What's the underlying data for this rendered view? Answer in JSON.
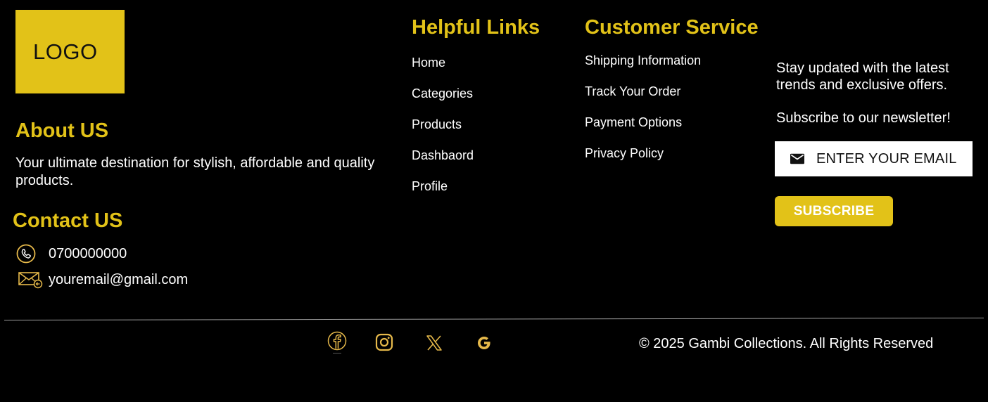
{
  "logo": {
    "text": "LOGO"
  },
  "about": {
    "heading": "About US",
    "text": "Your ultimate destination for stylish, affordable and quality products."
  },
  "contact": {
    "heading": "Contact US",
    "phone": "0700000000",
    "email": "youremail@gmail.com"
  },
  "helpful_links": {
    "heading": "Helpful Links",
    "items": [
      "Home",
      "Categories",
      "Products",
      "Dashbaord",
      "Profile"
    ]
  },
  "customer_service": {
    "heading": "Customer Service",
    "items": [
      "Shipping Information",
      "Track Your Order",
      "Payment Options",
      "Privacy Policy"
    ]
  },
  "newsletter": {
    "text": "Stay updated with the latest trends and exclusive offers.",
    "subtext": "Subscribe to our newsletter!",
    "email_placeholder": "ENTER YOUR EMAIL",
    "email_value": "",
    "button_label": "SUBSCRIBE"
  },
  "social": {
    "icons": [
      "facebook-icon",
      "instagram-icon",
      "x-icon",
      "google-icon"
    ]
  },
  "footer": {
    "copyright": "© 2025 Gambi Collections. All Rights Reserved"
  },
  "colors": {
    "accent": "#e2c218",
    "background": "#000000",
    "text": "#ffffff",
    "icon_gold": "#e6b94a"
  }
}
